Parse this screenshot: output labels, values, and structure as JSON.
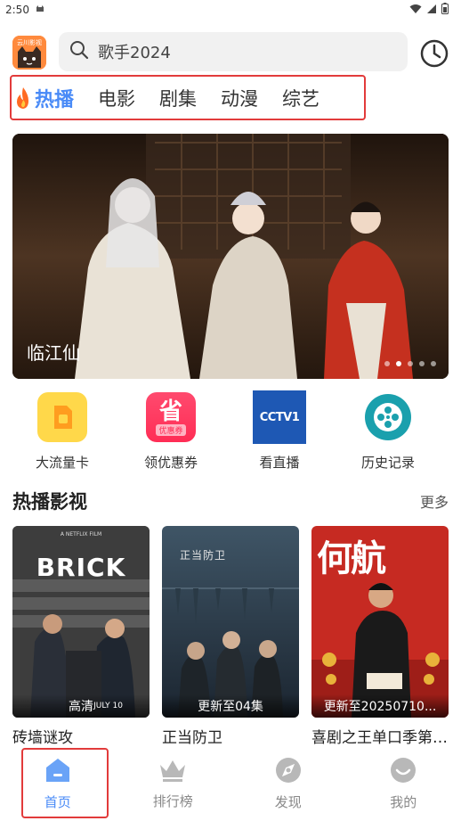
{
  "status_bar": {
    "time": "2:50"
  },
  "header": {
    "logo_text": "云川影视",
    "search_placeholder": "歌手2024"
  },
  "tabs": [
    {
      "label": "热播",
      "active": true
    },
    {
      "label": "电影",
      "active": false
    },
    {
      "label": "剧集",
      "active": false
    },
    {
      "label": "动漫",
      "active": false
    },
    {
      "label": "综艺",
      "active": false
    }
  ],
  "banner": {
    "title": "临江仙",
    "dots": 5,
    "active_dot": 2
  },
  "quick_entries": [
    {
      "label": "大流量卡",
      "icon": "sim-card-icon",
      "color": "#ffd84a"
    },
    {
      "label": "领优惠券",
      "icon": "coupon-icon",
      "color": "#ff4068",
      "icon_text": "省",
      "icon_subtext": "优惠券"
    },
    {
      "label": "看直播",
      "icon": "cctv1-icon",
      "color": "#1e58b4",
      "icon_text": "CCTV1"
    },
    {
      "label": "历史记录",
      "icon": "film-reel-icon",
      "color": "#1aa0ad"
    }
  ],
  "section": {
    "title": "热播影视",
    "more": "更多"
  },
  "cards": [
    {
      "title": "砖墙谜攻",
      "badge": "高清",
      "poster_text": "BRICK",
      "poster_top": "A NETFLIX FILM",
      "poster_bottom": "JULY 10"
    },
    {
      "title": "正当防卫",
      "badge": "更新至04集",
      "poster_text": "正当防卫"
    },
    {
      "title": "喜剧之王单口季第二季",
      "badge": "更新至20250710...",
      "poster_text": "何航"
    }
  ],
  "bottom_nav": [
    {
      "label": "首页",
      "icon": "home-icon",
      "active": true
    },
    {
      "label": "排行榜",
      "icon": "crown-icon",
      "active": false
    },
    {
      "label": "发现",
      "icon": "compass-icon",
      "active": false
    },
    {
      "label": "我的",
      "icon": "profile-icon",
      "active": false
    }
  ]
}
